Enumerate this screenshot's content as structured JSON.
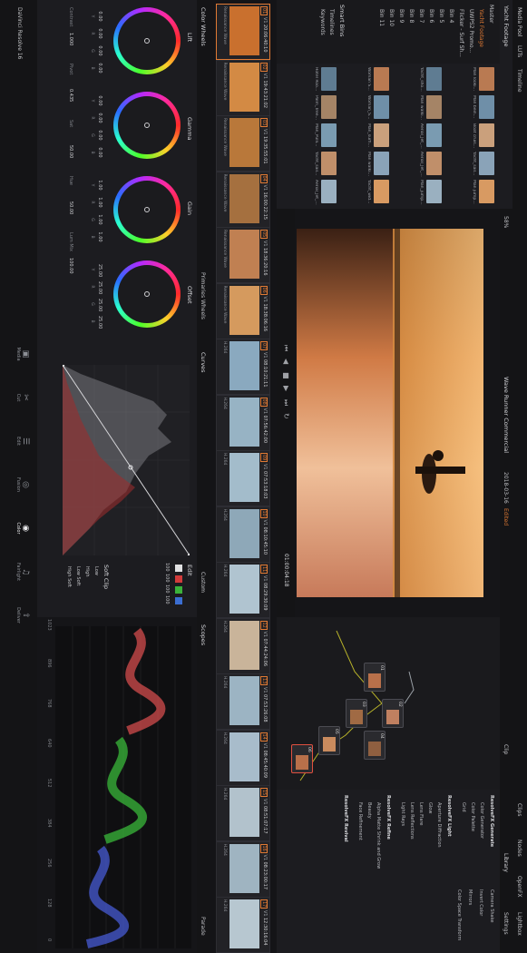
{
  "app": {
    "name": "DaVinci Resolve 16",
    "project": "Wave Runner Commercial",
    "date": "2018-03-16",
    "color_accent": "#e07a34"
  },
  "top_toolbar": {
    "items": [
      "Media Pool",
      "LUTs",
      "Timeline"
    ],
    "right_items": [
      "Clips",
      "Nodes",
      "OpenFX",
      "Lightbox"
    ],
    "edited": "Edited"
  },
  "media_pool": {
    "title": "Yacht Footage",
    "bins": [
      "Master",
      "Yacht Footage",
      "UWPS2 Promo...",
      "Flicker - Surf Sh...",
      "Bin 4",
      "Bin 5",
      "Bin 6",
      "Bin 7",
      "Bin 8",
      "Bin 9",
      "Bin 10",
      "Bin 11"
    ],
    "smart_bins_title": "Smart Bins",
    "smart_bins": [
      "Timelines",
      "Keywords"
    ],
    "clips": [
      "Man looking_Bl...",
      "Man being_Bl...",
      "Boat cruising_S...",
      "Yacht_sail_S...",
      "Man jumping_S...",
      "Yacht_shot_S...",
      "Man walking_J...",
      "Aerial_Jet_Ski...",
      "Aerial_Jet_Ski...",
      "Man_jumping...",
      "Woman Surfing...",
      "Woman_Surfing...",
      "Man_surfing_S...",
      "Man walking_R...",
      "Yacht_wide_S...",
      "Hotel Room_S...",
      "Palm_Trees_S...",
      "Man_Pulling_...",
      "Yacht_sail_L...",
      "Aerial_Jet_Ski..."
    ]
  },
  "viewer": {
    "fit": "58%",
    "title": "Wave Runner Commercial",
    "date": "2018-03-16",
    "clip_label": "Clip",
    "timecode": "01:00:04:18"
  },
  "timeline_clips": [
    {
      "num": "01",
      "v": "V1",
      "tc": "20:06:40:10",
      "label": "Renaissance Wave"
    },
    {
      "num": "02",
      "v": "V1",
      "tc": "19:43:21:02",
      "label": "Renaissance Wave"
    },
    {
      "num": "03",
      "v": "V1",
      "tc": "19:35:55:01",
      "label": "Renaissance Wave"
    },
    {
      "num": "04",
      "v": "V1",
      "tc": "16:00:22:15",
      "label": "Renaissance Wave"
    },
    {
      "num": "05",
      "v": "V1",
      "tc": "18:36:20:16",
      "label": "Renaissance Wave"
    },
    {
      "num": "06",
      "v": "V1",
      "tc": "18:38:06:16",
      "label": "Renaissance Wave"
    },
    {
      "num": "07",
      "v": "V1",
      "tc": "08:10:21:11",
      "label": "H.264"
    },
    {
      "num": "08",
      "v": "V1",
      "tc": "07:56:42:00",
      "label": "H.264"
    },
    {
      "num": "09",
      "v": "V1",
      "tc": "07:53:18:03",
      "label": "H.264"
    },
    {
      "num": "10",
      "v": "V1",
      "tc": "08:10:45:10",
      "label": "H.264"
    },
    {
      "num": "11",
      "v": "V1",
      "tc": "08:29:30:09",
      "label": "H.264"
    },
    {
      "num": "12",
      "v": "V1",
      "tc": "07:44:24:06",
      "label": "H.264"
    },
    {
      "num": "13",
      "v": "V1",
      "tc": "07:53:26:08",
      "label": "H.264"
    },
    {
      "num": "14",
      "v": "V1",
      "tc": "08:45:40:09",
      "label": "H.264"
    },
    {
      "num": "15",
      "v": "V1",
      "tc": "08:51:07:17",
      "label": "H.264"
    },
    {
      "num": "16",
      "v": "V1",
      "tc": "08:23:00:17",
      "label": "H.264"
    },
    {
      "num": "17",
      "v": "V1",
      "tc": "12:30:16:04",
      "label": "H.264"
    }
  ],
  "nodes": [
    {
      "label": "01"
    },
    {
      "label": "02"
    },
    {
      "label": "03"
    },
    {
      "label": "04"
    },
    {
      "label": "05"
    },
    {
      "label": "06"
    }
  ],
  "openfx": {
    "header_library": "Library",
    "header_settings": "Settings",
    "sections": [
      {
        "title": "ResolveFX Generate",
        "items": [
          "Color Generator",
          "Color Palette",
          "Grid"
        ]
      },
      {
        "title": "ResolveFX Light",
        "items": [
          "Aperture Diffraction",
          "Glow",
          "Lens Flare",
          "Lens Reflections",
          "Light Rays"
        ]
      },
      {
        "title": "ResolveFX Refine",
        "items": [
          "Alpha Matte Shrink and Grow",
          "Beauty",
          "Face Refinement"
        ]
      },
      {
        "title": "ResolveFX Revival",
        "items": []
      }
    ],
    "side_items": [
      "Camera Shake",
      "Invert Color",
      "Mirrors",
      "Color Space Transform"
    ]
  },
  "color_wheels": {
    "title": "Color Wheels",
    "mode": "Primaries Wheels",
    "wheels": [
      {
        "name": "Lift",
        "values": [
          "0.00",
          "0.00",
          "0.00",
          "0.00"
        ],
        "channels": [
          "Y",
          "R",
          "G",
          "B"
        ]
      },
      {
        "name": "Gamma",
        "values": [
          "0.00",
          "0.00",
          "0.00",
          "0.00"
        ],
        "channels": [
          "Y",
          "R",
          "G",
          "B"
        ]
      },
      {
        "name": "Gain",
        "values": [
          "1.00",
          "1.00",
          "1.00",
          "1.00"
        ],
        "channels": [
          "Y",
          "R",
          "G",
          "B"
        ]
      },
      {
        "name": "Offset",
        "values": [
          "25.00",
          "25.00",
          "25.00",
          "25.00"
        ],
        "channels": [
          "Y",
          "R",
          "G",
          "B"
        ]
      }
    ],
    "params": [
      {
        "label": "Contrast",
        "value": "1.000"
      },
      {
        "label": "Pivot",
        "value": "0.435"
      },
      {
        "label": "Sat",
        "value": "50.00"
      },
      {
        "label": "Hue",
        "value": "50.00"
      },
      {
        "label": "Lum Mix",
        "value": "100.00"
      }
    ]
  },
  "curves": {
    "title": "Curves",
    "mode": "Custom",
    "edit_label": "Edit",
    "softclip_label": "Soft Clip",
    "softclip_items": [
      "Low",
      "High",
      "Low Soft",
      "High Soft"
    ],
    "channel_values": [
      "100",
      "100",
      "100",
      "100"
    ]
  },
  "scopes": {
    "title": "Scopes",
    "mode": "Parade",
    "scale": [
      "1023",
      "896",
      "768",
      "640",
      "512",
      "384",
      "256",
      "128",
      "0"
    ]
  },
  "pages": [
    "Media",
    "Cut",
    "Edit",
    "Fusion",
    "Color",
    "Fairlight",
    "Deliver"
  ],
  "active_page": "Color"
}
